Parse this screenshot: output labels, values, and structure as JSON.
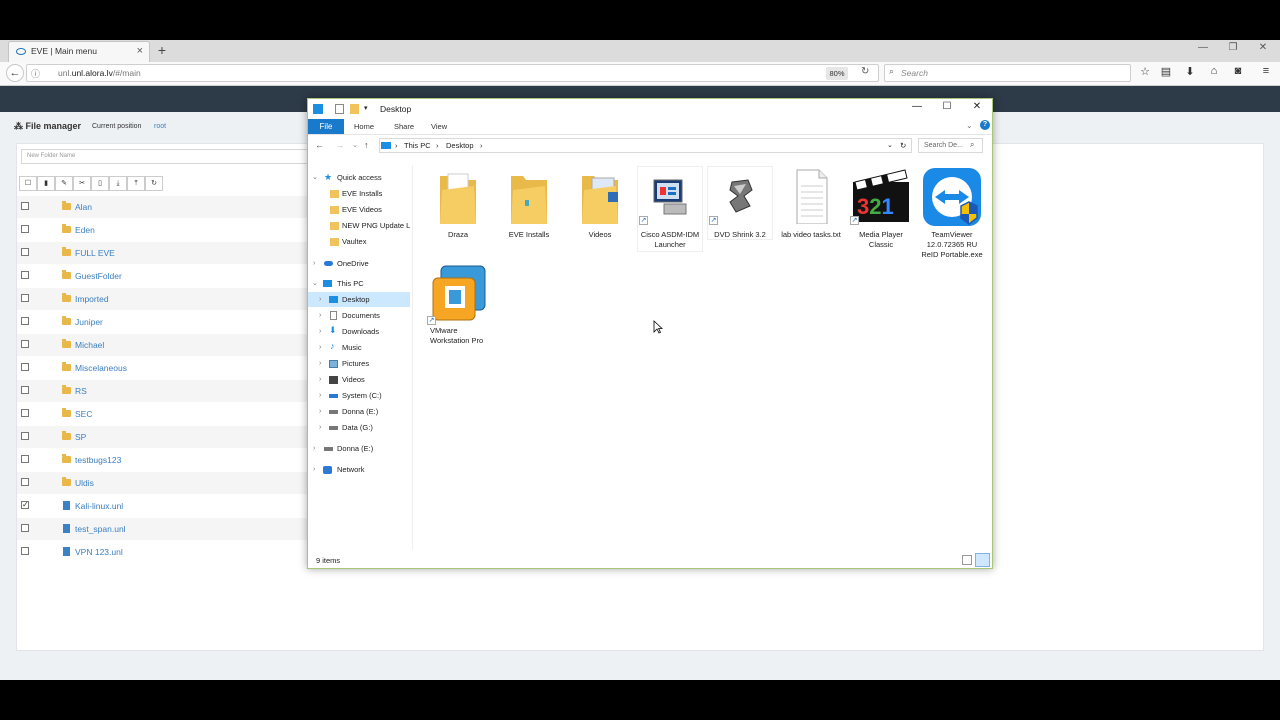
{
  "browser": {
    "tab_title": "EVE | Main menu",
    "tab_close": "×",
    "new_tab": "+",
    "url_host": "unl.alora.lv",
    "url_path": "/#/main",
    "url_prefix": "unl.",
    "zoom": "80%",
    "search_placeholder": "Search"
  },
  "file_manager": {
    "title": "File manager",
    "current_position_label": "Current position",
    "current_position_value": "root",
    "new_folder_placeholder": "New Folder Name",
    "items": [
      {
        "name": "Alan",
        "type": "folder",
        "checked": false
      },
      {
        "name": "Eden",
        "type": "folder",
        "checked": false
      },
      {
        "name": "FULL EVE",
        "type": "folder",
        "checked": false
      },
      {
        "name": "GuestFolder",
        "type": "folder",
        "checked": false
      },
      {
        "name": "Imported",
        "type": "folder",
        "checked": false
      },
      {
        "name": "Juniper",
        "type": "folder",
        "checked": false
      },
      {
        "name": "Michael",
        "type": "folder",
        "checked": false
      },
      {
        "name": "Miscelaneous",
        "type": "folder",
        "checked": false
      },
      {
        "name": "RS",
        "type": "folder",
        "checked": false
      },
      {
        "name": "SEC",
        "type": "folder",
        "checked": false
      },
      {
        "name": "SP",
        "type": "folder",
        "checked": false
      },
      {
        "name": "testbugs123",
        "type": "folder",
        "checked": false
      },
      {
        "name": "Uldis",
        "type": "folder",
        "checked": false
      },
      {
        "name": "Kali-linux.unl",
        "type": "file",
        "checked": true
      },
      {
        "name": "test_span.unl",
        "type": "file",
        "checked": false
      },
      {
        "name": "VPN 123.unl",
        "type": "file",
        "checked": false
      }
    ]
  },
  "explorer": {
    "title": "Desktop",
    "ribbon": {
      "file": "File",
      "home": "Home",
      "share": "Share",
      "view": "View"
    },
    "breadcrumb": [
      "This PC",
      "Desktop"
    ],
    "search_placeholder": "Search De...",
    "nav": {
      "quick_access": "Quick access",
      "quick_items": [
        "EVE Installs",
        "EVE Videos",
        "NEW PNG Update L",
        "Vaultex"
      ],
      "onedrive": "OneDrive",
      "this_pc": "This PC",
      "pc_items": [
        "Desktop",
        "Documents",
        "Downloads",
        "Music",
        "Pictures",
        "Videos",
        "System (C:)",
        "Donna (E:)",
        "Data (G:)"
      ],
      "donna": "Donna (E:)",
      "network": "Network"
    },
    "items": [
      {
        "line1": "Draza",
        "line2": "",
        "line3": ""
      },
      {
        "line1": "EVE Installs",
        "line2": "",
        "line3": ""
      },
      {
        "line1": "Videos",
        "line2": "",
        "line3": ""
      },
      {
        "line1": "Cisco ASDM-IDM",
        "line2": "Launcher",
        "line3": ""
      },
      {
        "line1": "DVD Shrink 3.2",
        "line2": "",
        "line3": ""
      },
      {
        "line1": "lab video tasks.txt",
        "line2": "",
        "line3": ""
      },
      {
        "line1": "Media Player",
        "line2": "Classic",
        "line3": ""
      },
      {
        "line1": "TeamViewer",
        "line2": "12.0.72365 RU",
        "line3": "ReID Portable.exe"
      },
      {
        "line1": "VMware",
        "line2": "Workstation Pro",
        "line3": ""
      }
    ],
    "status": "9 items",
    "mpc_digits": "321"
  }
}
